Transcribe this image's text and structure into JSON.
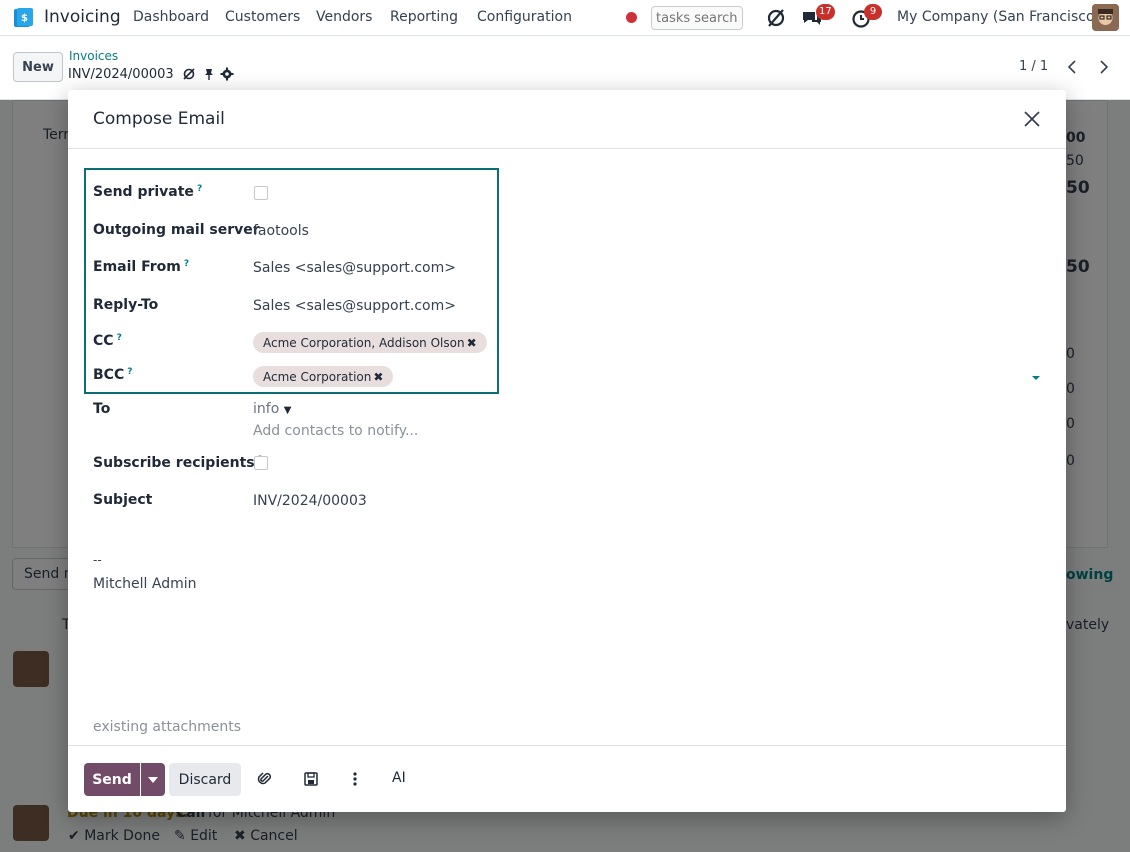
{
  "navbar": {
    "app_name": "Invoicing",
    "menus": [
      "Dashboard",
      "Customers",
      "Vendors",
      "Reporting",
      "Configuration"
    ],
    "search_placeholder": "tasks search",
    "messages_count": "17",
    "activities_count": "9",
    "company": "My Company (San Francisco)"
  },
  "control_panel": {
    "new_label": "New",
    "breadcrumb": "Invoices",
    "record": "INV/2024/00003",
    "pager": "1 / 1"
  },
  "background": {
    "terms_label": "Terr",
    "amounts": [
      "00",
      "50",
      "50",
      "50"
    ],
    "right_vals": [
      "0",
      "0",
      "0",
      "0"
    ],
    "send_message": "Send m",
    "following": "owing",
    "privately": "vately",
    "t_letter": "T",
    "due_text": "Due in 10 days:",
    "call_text": "Call",
    "for_text": "for Mitchell Admin",
    "mark_done": "Mark Done",
    "edit": "Edit",
    "cancel": "Cancel"
  },
  "modal": {
    "title": "Compose Email",
    "fields": {
      "send_private_label": "Send private",
      "outgoing_label": "Outgoing mail server",
      "outgoing_value": "faotools",
      "email_from_label": "Email From",
      "email_from_value": "Sales <sales@support.com>",
      "reply_to_label": "Reply-To",
      "reply_to_value": "Sales <sales@support.com>",
      "cc_label": "CC",
      "cc_tag": "Acme Corporation, Addison Olson",
      "bcc_label": "BCC",
      "bcc_tag": "Acme Corporation",
      "to_label": "To",
      "to_value": "info",
      "to_placeholder": "Add contacts to notify...",
      "subscribe_label": "Subscribe recipients",
      "subject_label": "Subject",
      "subject_value": "INV/2024/00003"
    },
    "help_mark": "?",
    "signature_dash": "--",
    "signature_name": "Mitchell Admin",
    "attachments_placeholder": "existing attachments",
    "footer": {
      "send_label": "Send",
      "discard_label": "Discard",
      "ai_label": "AI"
    }
  },
  "colors": {
    "primary": "#714b67",
    "teal": "#017e84",
    "highlight_border": "#0b6e77",
    "badge": "#c9302c"
  }
}
